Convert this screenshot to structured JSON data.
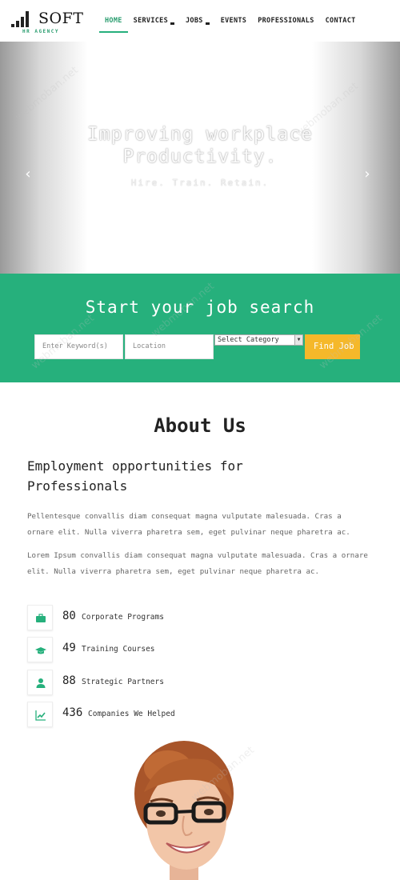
{
  "brand": {
    "title": "SOFT",
    "subtitle": "HR AGENCY"
  },
  "nav": {
    "items": [
      {
        "label": "HOME",
        "active": true,
        "dropdown": false
      },
      {
        "label": "SERVICES",
        "active": false,
        "dropdown": true
      },
      {
        "label": "JOBS",
        "active": false,
        "dropdown": true
      },
      {
        "label": "EVENTS",
        "active": false,
        "dropdown": false
      },
      {
        "label": "PROFESSIONALS",
        "active": false,
        "dropdown": false
      },
      {
        "label": "CONTACT",
        "active": false,
        "dropdown": false
      }
    ]
  },
  "hero": {
    "title_line1": "Improving workplace",
    "title_line2": "Productivity.",
    "subtitle": "Hire. Train. Retain.",
    "prev_icon": "chevron-left-icon",
    "next_icon": "chevron-right-icon"
  },
  "search": {
    "title": "Start your job search",
    "keyword_placeholder": "Enter Keyword(s)",
    "location_placeholder": "Location",
    "category_selected": "Select Category",
    "button_label": "Find Job"
  },
  "about": {
    "title": "About Us",
    "heading_line1": "Employment opportunities for",
    "heading_line2": "Professionals",
    "paragraph1": "Pellentesque convallis diam consequat magna vulputate malesuada. Cras a ornare elit. Nulla viverra pharetra sem, eget pulvinar neque pharetra ac.",
    "paragraph2": "Lorem Ipsum convallis diam consequat magna vulputate malesuada. Cras a ornare elit. Nulla viverra pharetra sem, eget pulvinar neque pharetra ac."
  },
  "stats": [
    {
      "icon": "briefcase-icon",
      "number": "80",
      "label": "Corporate Programs"
    },
    {
      "icon": "graduation-cap-icon",
      "number": "49",
      "label": "Training Courses"
    },
    {
      "icon": "user-icon",
      "number": "88",
      "label": "Strategic Partners"
    },
    {
      "icon": "line-chart-icon",
      "number": "436",
      "label": "Companies We Helped"
    }
  ],
  "colors": {
    "accent": "#26b07c",
    "button": "#f5b82a",
    "text": "#222222"
  }
}
